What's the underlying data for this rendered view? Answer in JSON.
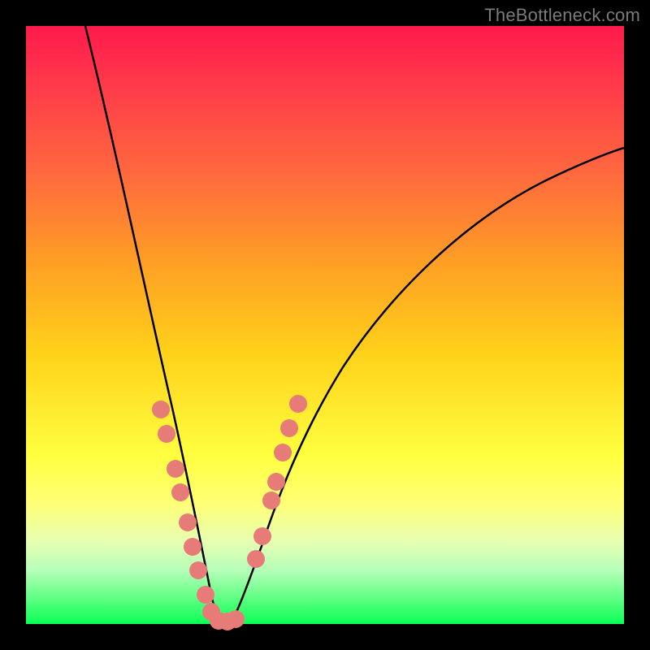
{
  "watermark": {
    "text": "TheBottleneck.com"
  },
  "chart_data": {
    "type": "line",
    "title": "",
    "xlabel": "",
    "ylabel": "",
    "xlim": [
      0,
      100
    ],
    "ylim": [
      0,
      100
    ],
    "series": [
      {
        "name": "left-branch",
        "x": [
          10,
          12,
          14,
          16,
          18,
          20,
          22,
          24,
          26,
          28,
          30,
          31,
          32
        ],
        "y": [
          100,
          90,
          80,
          70,
          60,
          50,
          40,
          30,
          20,
          12,
          5,
          1,
          0
        ]
      },
      {
        "name": "right-branch",
        "x": [
          34,
          36,
          38,
          40,
          44,
          48,
          52,
          58,
          64,
          70,
          78,
          86,
          94,
          100
        ],
        "y": [
          0,
          3,
          9,
          16,
          28,
          38,
          46,
          55,
          62,
          67,
          72,
          76,
          79,
          81
        ]
      }
    ],
    "scatter": [
      {
        "name": "left-dots",
        "color": "#e77b78",
        "points": [
          {
            "x": 22.5,
            "y": 36
          },
          {
            "x": 23.5,
            "y": 32
          },
          {
            "x": 25.0,
            "y": 26
          },
          {
            "x": 25.8,
            "y": 22
          },
          {
            "x": 27.0,
            "y": 17
          },
          {
            "x": 27.8,
            "y": 13
          },
          {
            "x": 28.8,
            "y": 9
          },
          {
            "x": 30.0,
            "y": 5
          },
          {
            "x": 31.0,
            "y": 2
          },
          {
            "x": 32.0,
            "y": 0.5
          },
          {
            "x": 33.0,
            "y": 0.4
          },
          {
            "x": 34.0,
            "y": 0.4
          },
          {
            "x": 35.0,
            "y": 0.8
          }
        ]
      },
      {
        "name": "right-dots",
        "color": "#e77b78",
        "points": [
          {
            "x": 38.5,
            "y": 11
          },
          {
            "x": 39.5,
            "y": 15
          },
          {
            "x": 41.0,
            "y": 21
          },
          {
            "x": 41.8,
            "y": 24
          },
          {
            "x": 43.0,
            "y": 29
          },
          {
            "x": 44.0,
            "y": 33
          },
          {
            "x": 45.5,
            "y": 37
          }
        ]
      }
    ],
    "background_gradient": {
      "stops": [
        {
          "pos": 0,
          "color": "#ff1a4d"
        },
        {
          "pos": 55,
          "color": "#ffd21a"
        },
        {
          "pos": 100,
          "color": "#0aff57"
        }
      ]
    }
  }
}
